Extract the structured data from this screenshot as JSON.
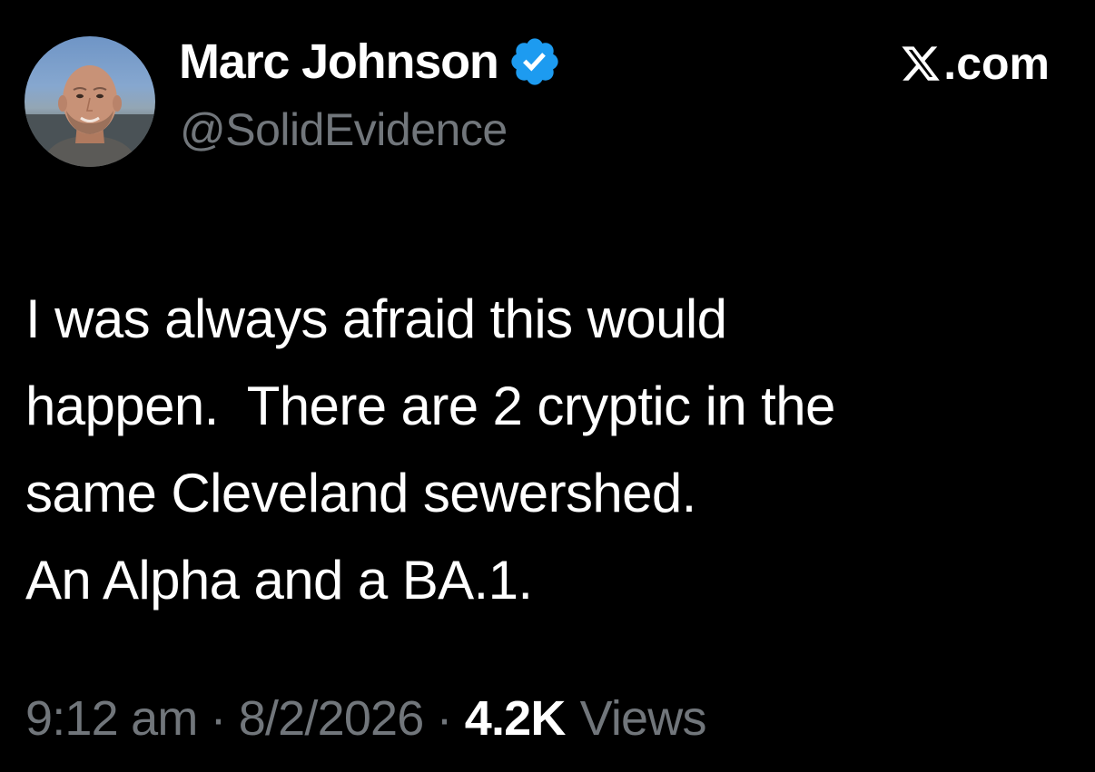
{
  "author": {
    "display_name": "Marc Johnson",
    "handle": "@SolidEvidence",
    "verified": true,
    "verified_badge_color": "#1d9bf0",
    "avatar_icon": "profile-photo"
  },
  "source": {
    "logo_icon": "x-logo",
    "label": ".com"
  },
  "tweet": {
    "lines": [
      "I was always afraid this would",
      "happen.  There are 2 cryptic in the",
      "same Cleveland sewershed.",
      "An Alpha and a BA.1."
    ]
  },
  "meta": {
    "time": "9:12 am",
    "separator": "·",
    "date": "8/2/2026",
    "views_count": "4.2K",
    "views_label": "Views"
  },
  "colors": {
    "background": "#000000",
    "primary_text": "#ffffff",
    "secondary_text": "#71767b"
  }
}
